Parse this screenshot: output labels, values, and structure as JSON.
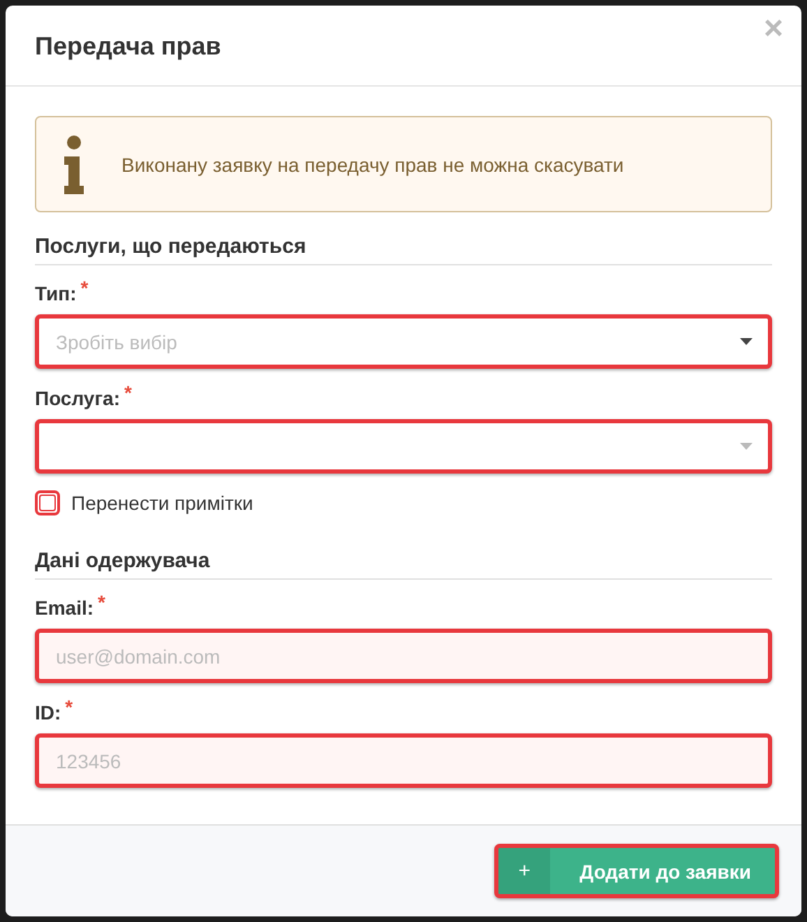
{
  "dialog": {
    "title": "Передача прав",
    "close": "×"
  },
  "alert": {
    "message": "Виконану заявку на передачу прав не можна скасувати"
  },
  "sections": [
    {
      "title": "Послуги, що передаються",
      "fields": [
        {
          "kind": "select",
          "label": "Тип:",
          "required_mark": "*",
          "placeholder": "Зробіть вибір",
          "invalid": true,
          "disabled": false
        },
        {
          "kind": "select",
          "label": "Послуга:",
          "required_mark": "*",
          "invalid": true,
          "disabled": true
        },
        {
          "kind": "checkbox",
          "label": "Перенести примітки",
          "checked": false,
          "invalid": true
        }
      ]
    },
    {
      "title": "Дані одержувача",
      "fields": [
        {
          "kind": "input",
          "label": "Email:",
          "required_mark": "*",
          "placeholder": "user@domain.com",
          "invalid": true
        },
        {
          "kind": "input",
          "label": "ID:",
          "required_mark": "*",
          "placeholder": "123456",
          "invalid": true
        }
      ]
    }
  ],
  "footer": {
    "button": {
      "icon": "+",
      "label": "Додати до заявки",
      "invalid": true
    }
  }
}
